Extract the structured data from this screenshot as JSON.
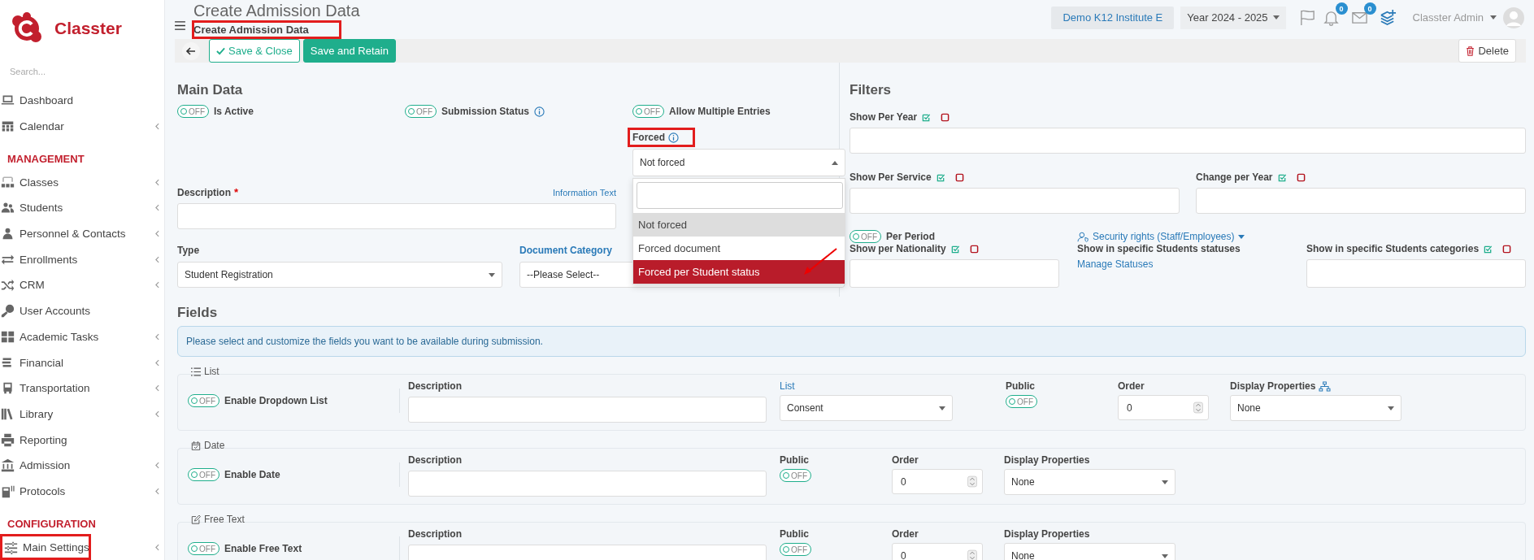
{
  "sidebar": {
    "brand": "Classter",
    "search": {
      "placeholder": "Search..."
    },
    "items": [
      {
        "kind": "link",
        "label": "Dashboard",
        "submenu": false,
        "highlighted": false
      },
      {
        "kind": "link",
        "label": "Calendar",
        "submenu": true,
        "highlighted": false
      },
      {
        "kind": "heading",
        "label": "MANAGEMENT"
      },
      {
        "kind": "link",
        "label": "Classes",
        "submenu": true,
        "highlighted": false
      },
      {
        "kind": "link",
        "label": "Students",
        "submenu": true,
        "highlighted": false
      },
      {
        "kind": "link",
        "label": "Personnel & Contacts",
        "submenu": true,
        "highlighted": false
      },
      {
        "kind": "link",
        "label": "Enrollments",
        "submenu": true,
        "highlighted": false
      },
      {
        "kind": "link",
        "label": "CRM",
        "submenu": true,
        "highlighted": false
      },
      {
        "kind": "link",
        "label": "User Accounts",
        "submenu": false,
        "highlighted": false
      },
      {
        "kind": "link",
        "label": "Academic Tasks",
        "submenu": true,
        "highlighted": false
      },
      {
        "kind": "link",
        "label": "Financial",
        "submenu": true,
        "highlighted": false
      },
      {
        "kind": "link",
        "label": "Transportation",
        "submenu": true,
        "highlighted": false
      },
      {
        "kind": "link",
        "label": "Library",
        "submenu": true,
        "highlighted": false
      },
      {
        "kind": "link",
        "label": "Reporting",
        "submenu": false,
        "highlighted": false
      },
      {
        "kind": "link",
        "label": "Admission",
        "submenu": true,
        "highlighted": false
      },
      {
        "kind": "link",
        "label": "Protocols",
        "submenu": true,
        "highlighted": false
      },
      {
        "kind": "heading",
        "label": "CONFIGURATION"
      },
      {
        "kind": "link",
        "label": "Main Settings",
        "submenu": true,
        "highlighted": true
      }
    ]
  },
  "header": {
    "title": "Create Admission Data",
    "breadcrumb": {
      "text": "Create Admission Data",
      "highlighted": true
    },
    "institute": "Demo K12 Institute E",
    "year": "Year 2024 - 2025",
    "notifications": "0",
    "messages": "0",
    "user": "Classter Admin"
  },
  "toolbar": {
    "buttons": [
      {
        "kind": "outline",
        "label": "Save & Close"
      },
      {
        "kind": "solid",
        "label": "Save and Retain"
      },
      {
        "kind": "delete",
        "label": "Delete"
      }
    ]
  },
  "main_data": {
    "heading": "Main Data",
    "toggles": [
      {
        "label": "Is Active",
        "state": "OFF",
        "on": false,
        "info": false
      },
      {
        "label": "Submission Status",
        "state": "OFF",
        "on": false,
        "info": true
      },
      {
        "label": "Allow Multiple Entries",
        "state": "OFF",
        "on": false,
        "info": false
      }
    ],
    "forced": {
      "label": "Forced",
      "highlighted": true,
      "value": "Not forced",
      "expanded": true,
      "annotation_arrow": true,
      "options": [
        {
          "label": "Not forced",
          "selected": true,
          "hovered": false
        },
        {
          "label": "Forced document",
          "selected": false,
          "hovered": false
        },
        {
          "label": "Forced per Student status",
          "selected": false,
          "hovered": true
        }
      ]
    },
    "description": {
      "label": "Description",
      "required_mark": "*",
      "link": "Information Text"
    },
    "type": {
      "label": "Type",
      "value": "Student Registration"
    },
    "document_category": {
      "label": "Document Category",
      "value": "--Please Select--"
    }
  },
  "filters": {
    "heading": "Filters",
    "show_per_year": {
      "label": "Show Per Year"
    },
    "show_per_service": {
      "label": "Show Per Service"
    },
    "change_per_year": {
      "label": "Change per Year"
    },
    "per_period": {
      "label": "Per Period",
      "state": "OFF",
      "on": false
    },
    "security_rights": "Security rights (Staff/Employees)",
    "show_per_nationality": {
      "label": "Show per Nationality"
    },
    "statuses": {
      "label": "Show in specific Students statuses",
      "link": "Manage Statuses"
    },
    "categories": {
      "label": "Show in specific Students categories"
    }
  },
  "fields": {
    "heading": "Fields",
    "info": "Please select and customize the fields you want to be available during submission.",
    "groups": [
      {
        "kind": "list",
        "title": "List",
        "enable": {
          "label": "Enable Dropdown List",
          "state": "OFF",
          "on": false
        },
        "description": "Description",
        "list": {
          "label": "List",
          "value": "Consent"
        },
        "public": {
          "label": "Public",
          "state": "OFF",
          "on": false
        },
        "order": {
          "label": "Order",
          "value": "0"
        },
        "display": {
          "label": "Display Properties",
          "value": "None"
        }
      },
      {
        "kind": "date",
        "title": "Date",
        "enable": {
          "label": "Enable Date",
          "state": "OFF",
          "on": false
        },
        "description": "Description",
        "public": {
          "label": "Public",
          "state": "OFF",
          "on": false
        },
        "order": {
          "label": "Order",
          "value": "0"
        },
        "display": {
          "label": "Display Properties",
          "value": "None"
        }
      },
      {
        "kind": "text",
        "title": "Free Text",
        "enable": {
          "label": "Enable Free Text",
          "state": "OFF",
          "on": false
        },
        "description": "Description",
        "public": {
          "label": "Public",
          "state": "OFF",
          "on": false
        },
        "order": {
          "label": "Order",
          "value": "0"
        },
        "display": {
          "label": "Display Properties",
          "value": "None"
        }
      }
    ]
  }
}
